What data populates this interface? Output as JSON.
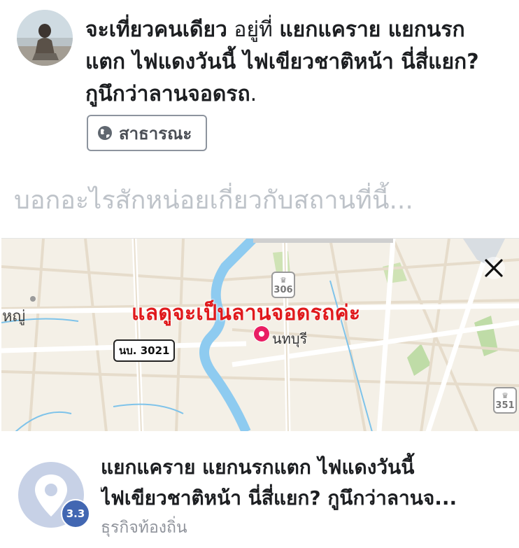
{
  "post": {
    "status_main": "จะเที่ยวคนเดียว",
    "status_connector": " อยู่ที่ ",
    "status_place_1": "แยกแคราย แยกนรก",
    "status_place_2": "แตก ไฟแดงวันนี้ ไฟเขียวชาติหน้า นี่สี่แยก?",
    "status_place_3": "กูนึกว่าลานจอดรถ",
    "status_end": ".",
    "privacy_label": "สาธารณะ",
    "privacy_icon": "globe-icon"
  },
  "place_input": {
    "placeholder": "บอกอะไรสักหน่อยเกี่ยวกับสถานที่นี้..."
  },
  "map": {
    "annotation": "แลดูจะเป็นลานจอดรถค่ะ",
    "city_label": "นทบุรี",
    "left_label": "หญู่",
    "route_label": "นบ. 3021",
    "shield_a": "306",
    "shield_b": "351",
    "pin_color": "#e91e63",
    "close_icon": "close-icon"
  },
  "place_card": {
    "name_line_1": "แยกแคราย แยกนรกแตก ไฟแดงวันนี้",
    "name_line_2": "ไฟเขียวชาติหน้า นี่สี่แยก? กูนึกว่าลานจ...",
    "category": "ธุรกิจท้องถิ่น",
    "rating": "3.3",
    "rating_color": "#4267b2",
    "icon": "map-pin-icon"
  }
}
